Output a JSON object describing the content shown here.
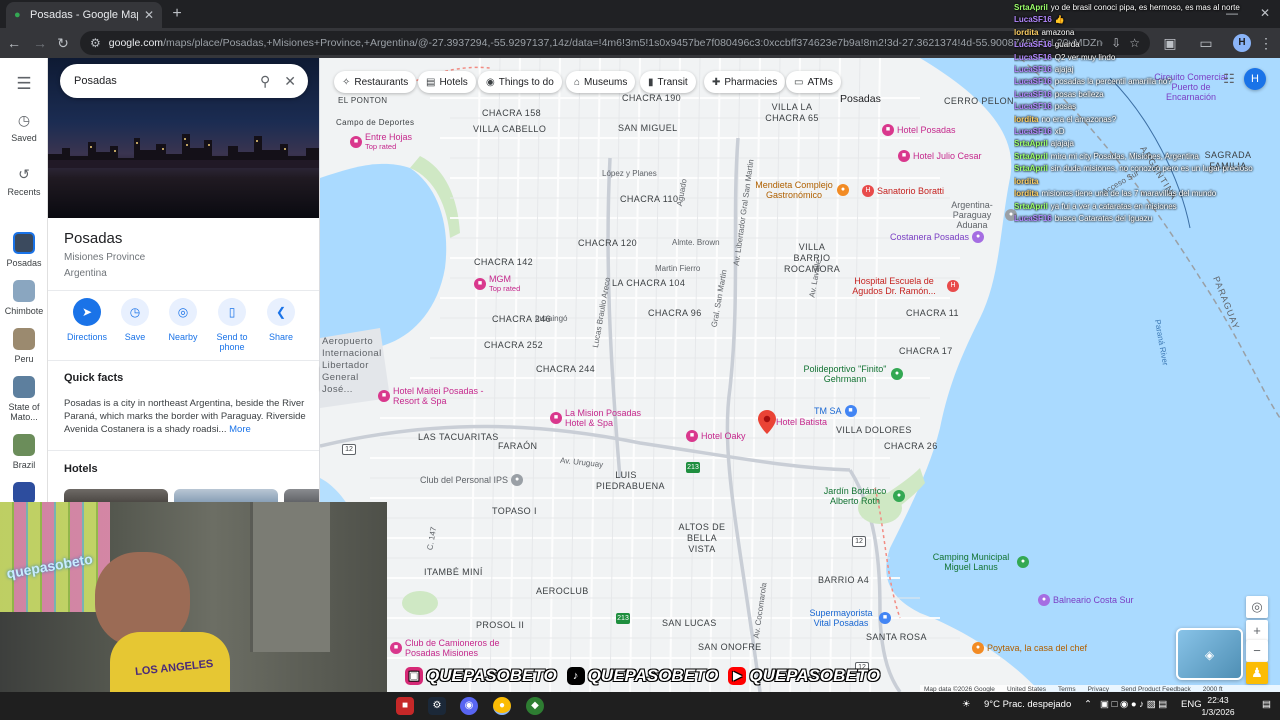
{
  "browser": {
    "tab_title": "Posadas - Google Maps",
    "url_host": "google.com",
    "url_rest": "/maps/place/Posadas,+Misiones+Province,+Argentina/@-27.3937294,-55.9297137,14z/data=!4m6!3m5!1s0x9457be7f080496c3:0xccbff374623e7b9a!8m2!3d-27.3621374!4d-55.9008746!16zL20vMDZncXMy?entry=ttu&g_ep=EgoyM",
    "profile_initial": "H"
  },
  "rail": {
    "saved": "Saved",
    "recents": "Recents",
    "history": [
      {
        "label": "Posadas",
        "color": "#3b4a5e"
      },
      {
        "label": "Chimbote",
        "color": "#8aa6c0"
      },
      {
        "label": "Peru",
        "color": "#9b8a6f"
      },
      {
        "label": "State of Mato...",
        "color": "#5d7f9e"
      },
      {
        "label": "Brazil",
        "color": "#6b8d5a"
      }
    ]
  },
  "panel": {
    "search_value": "Posadas",
    "title": "Posadas",
    "subtitle1": "Misiones Province",
    "subtitle2": "Argentina",
    "actions": [
      {
        "label": "Directions",
        "icon": "directions-icon"
      },
      {
        "label": "Save",
        "icon": "bookmark-icon"
      },
      {
        "label": "Nearby",
        "icon": "nearby-icon"
      },
      {
        "label": "Send to phone",
        "icon": "phone-icon"
      },
      {
        "label": "Share",
        "icon": "share-icon"
      }
    ],
    "quick_facts_heading": "Quick facts",
    "quick_facts_text": "Posadas is a city in northeast Argentina, beside the River Paraná, which marks the border with Paraguay. Riverside Avenida Costanera is a shady roadsi...",
    "more_label": "More",
    "hotels_heading": "Hotels"
  },
  "chips": [
    {
      "label": "Restaurants",
      "icon": "fork-knife-icon"
    },
    {
      "label": "Hotels",
      "icon": "bed-icon"
    },
    {
      "label": "Things to do",
      "icon": "camera-icon"
    },
    {
      "label": "Museums",
      "icon": "museum-icon"
    },
    {
      "label": "Transit",
      "icon": "train-icon"
    },
    {
      "label": "Pharmacies",
      "icon": "pharmacy-icon"
    },
    {
      "label": "ATMs",
      "icon": "atm-icon"
    }
  ],
  "map": {
    "area_labels": [
      "CHACRA 190",
      "CHACRA 158",
      "VILLA CABELLO",
      "SAN MIGUEL",
      "CHACRA 110",
      "CHACRA 120",
      "CHACRA 142",
      "LA CHACRA 104",
      "CHACRA 96",
      "CHACRA 246",
      "CHACRA 252",
      "CHACRA 244",
      "LAS TACUARITAS",
      "FARAÓN",
      "LUIS PIEDRABUENA",
      "VILLA DOLORES",
      "CHACRA 26",
      "CHACRA 17",
      "CHACRA 11",
      "VILLA BARRIO ROCAMORA",
      "VILLA LA CHACRA 65",
      "CERRO PELON",
      "SAGRADA FAMILIA",
      "TOPASO I",
      "ALTOS DE BELLA VISTA",
      "AEROCLUB",
      "ITAMBÉ MINÍ",
      "PROSOL II",
      "SAN LUCAS",
      "SAN ONOFRE",
      "BARRIO A4",
      "SANTA ROSA",
      "EL PONTON",
      "Campo de Deportes",
      "Aeropuerto Internacional Libertador General José..."
    ],
    "city_label": "Posadas",
    "country_label": "PARAGUAY",
    "country_label2": "ARGENTINA",
    "river_label": "Paraná River",
    "pois": [
      {
        "name": "Hotel Posadas",
        "kind": "pink"
      },
      {
        "name": "Hotel Julio Cesar",
        "kind": "pink"
      },
      {
        "name": "Mendieta Complejo Gastronómico",
        "kind": "orange"
      },
      {
        "name": "Sanatorio Boratti",
        "kind": "red"
      },
      {
        "name": "Costanera Posadas",
        "kind": "purple"
      },
      {
        "name": "Hospital Escuela de Agudos Dr. Ramón...",
        "kind": "red"
      },
      {
        "name": "Entre Hojas",
        "kind": "pink",
        "rated": "Top rated"
      },
      {
        "name": "MGM",
        "kind": "pink",
        "rated": "Top rated"
      },
      {
        "name": "Hotel Maitei Posadas - Resort & Spa",
        "kind": "pink"
      },
      {
        "name": "La Mision Posadas Hotel & Spa",
        "kind": "pink"
      },
      {
        "name": "Hotel Oaky",
        "kind": "pink"
      },
      {
        "name": "Hotel Batista",
        "kind": "pink"
      },
      {
        "name": "TM SA",
        "kind": "blue"
      },
      {
        "name": "Polideportivo \"Finito\" Gehrmann",
        "kind": "green"
      },
      {
        "name": "Club del Personal IPS",
        "kind": "gray"
      },
      {
        "name": "Jardín Botánico Alberto Roth",
        "kind": "green"
      },
      {
        "name": "Camping Municipal Miguel Lanus",
        "kind": "green"
      },
      {
        "name": "Balneario Costa Sur",
        "kind": "purple"
      },
      {
        "name": "Supermayorista Vital Posadas",
        "kind": "blue"
      },
      {
        "name": "Poytava, la casa del chef",
        "kind": "orange"
      },
      {
        "name": "Club de Camioneros de Posadas Misiones",
        "kind": "pink"
      },
      {
        "name": "Circuito Comercial Puerto de Encarnación",
        "kind": "purple"
      },
      {
        "name": "Argentina-Paraguay Aduana",
        "kind": "gray"
      }
    ],
    "streets": [
      "Martin Fierro",
      "Ituzaingó",
      "Almte. Brown",
      "Av. Lavalle",
      "Gral. San Martin",
      "Av. Cocomarola",
      "López y Planes",
      "Aguado",
      "Lucas Braulio Areco",
      "Av. Libertador Gral San Martin",
      "Acceso Sur",
      "Av. Uruguay",
      "C. 147"
    ],
    "shields": [
      "12",
      "12",
      "213",
      "213",
      "12"
    ],
    "attribution": [
      "Map data ©2026 Google",
      "United States",
      "Terms",
      "Privacy",
      "Send Product Feedback",
      "2000 ft"
    ]
  },
  "chat": [
    {
      "user": "SrtaApril",
      "color": "#9bff6b",
      "text": "yo de brasil conoci pipa, es hermoso, es mas al norte"
    },
    {
      "user": "LucaSF16",
      "color": "#b388ff",
      "text": "👍"
    },
    {
      "user": "lordita",
      "color": "#ffd166",
      "text": "amazona"
    },
    {
      "user": "LucaSF16",
      "color": "#b388ff",
      "text": "guarda"
    },
    {
      "user": "LucaSF16",
      "color": "#b388ff",
      "text": "Q2 ver muy lindo"
    },
    {
      "user": "LucaSF16",
      "color": "#b388ff",
      "text": "ajajaj"
    },
    {
      "user": "LucaSF16",
      "color": "#b388ff",
      "text": "posadas la percentil amarilla no?"
    },
    {
      "user": "LucaSF16",
      "color": "#b388ff",
      "text": "posas belleza"
    },
    {
      "user": "LucaSF16",
      "color": "#b388ff",
      "text": "posas"
    },
    {
      "user": "lordita",
      "color": "#ffd166",
      "text": "no era el amazonas?"
    },
    {
      "user": "LucaSF16",
      "color": "#b388ff",
      "text": "xD"
    },
    {
      "user": "SrtaApril",
      "color": "#9bff6b",
      "text": "ajajaja"
    },
    {
      "user": "SrtaApril",
      "color": "#9bff6b",
      "text": "mira mi city Posadas, Misiones, Argentina"
    },
    {
      "user": "SrtaApril",
      "color": "#9bff6b",
      "text": "sin duda misiones, no conozco pero es un lugar precioso"
    },
    {
      "user": "lordita",
      "color": "#ffd166",
      "text": ""
    },
    {
      "user": "lordita",
      "color": "#ffd166",
      "text": "misiones tiene una de las 7 maravillas del mundo"
    },
    {
      "user": "SrtaApril",
      "color": "#9bff6b",
      "text": "ya fui a ver a cataratas en misiones"
    },
    {
      "user": "LucaSF16",
      "color": "#b388ff",
      "text": "busca Cataratas del Iguazu"
    }
  ],
  "overlay": {
    "cam_tag": "quepasobeto",
    "shirt_text": "LOS ANGELES",
    "banner": [
      {
        "platform": "instagram-icon",
        "handle": "QUEPASOBETO",
        "color": "#d62976"
      },
      {
        "platform": "tiktok-icon",
        "handle": "QUEPASOBETO",
        "color": "#000000"
      },
      {
        "platform": "youtube-icon",
        "handle": "QUEPASOBETO",
        "color": "#ff0000"
      }
    ]
  },
  "taskbar": {
    "weather": "9°C  Prac. despejado",
    "lang": "ENG",
    "time": "22:43",
    "date": "1/3/2026"
  }
}
